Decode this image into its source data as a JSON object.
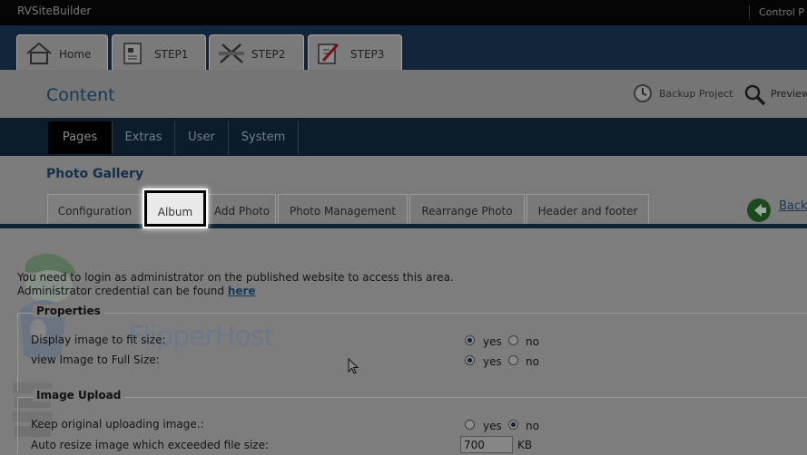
{
  "app": {
    "title": "RVSiteBuilder",
    "control_panel": "Control P"
  },
  "steps": [
    {
      "label": "Home",
      "icon": "house-icon"
    },
    {
      "label": "STEP1",
      "icon": "document-icon"
    },
    {
      "label": "STEP2",
      "icon": "tools-icon"
    },
    {
      "label": "STEP3",
      "icon": "pencil-icon",
      "active": true
    }
  ],
  "content": {
    "title": "Content",
    "backup_label": "Backup Project",
    "preview_label": "Preview"
  },
  "menu": [
    "Pages",
    "Extras",
    "User",
    "System"
  ],
  "gallery": {
    "title": "Photo Gallery",
    "tabs": [
      "Configuration",
      "Album",
      "Add Photo",
      "Photo Management",
      "Rearrange Photo",
      "Header and footer"
    ],
    "back_label": "Back"
  },
  "notice": {
    "line1": "You need to login as administrator on the published website to access this area.",
    "line2_prefix": "Administrator credential can be found",
    "link": "here"
  },
  "properties": {
    "legend": "Properties",
    "rows": [
      {
        "label": "Display image to fit size:",
        "yes": "yes",
        "no": "no",
        "value": "yes"
      },
      {
        "label": "view Image to Full Size:",
        "yes": "yes",
        "no": "no",
        "value": "yes"
      }
    ]
  },
  "image_upload": {
    "legend": "Image Upload",
    "keep_label": "Keep original uploading image.:",
    "keep_yes": "yes",
    "keep_no": "no",
    "keep_value": "no",
    "resize_label": "Auto resize image which exceeded file size:",
    "resize_value": "700",
    "resize_unit": "KB"
  },
  "watermark": {
    "brand": "FlipperHost",
    "badge": "FLIPPER HOST"
  },
  "colors": {
    "top_bar": "#050505",
    "step_bar": "#11243a",
    "menu_bar": "#0d1c2a",
    "accent_text": "#143a57"
  }
}
